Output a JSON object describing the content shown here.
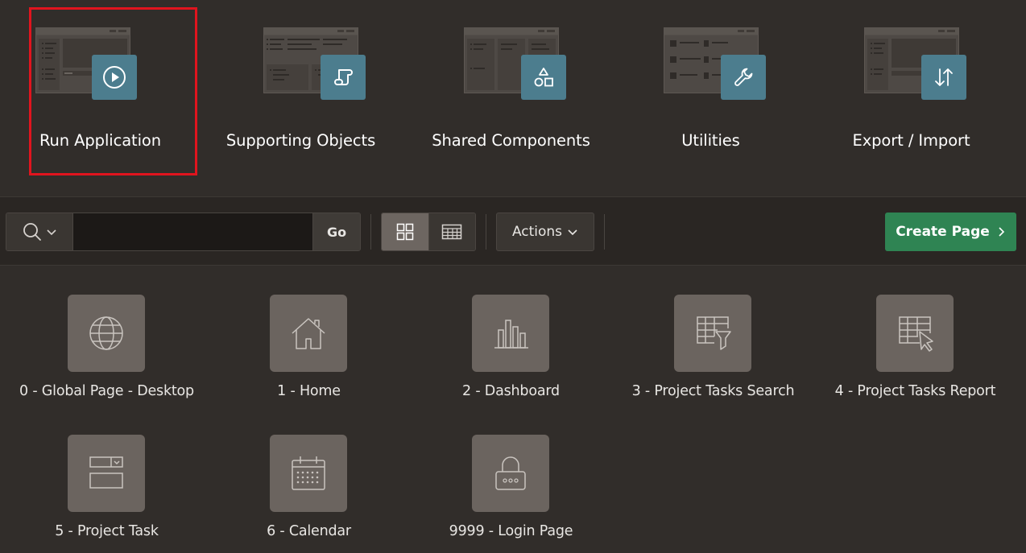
{
  "hero_tiles": [
    {
      "label": "Run Application",
      "icon": "play-icon",
      "selected": true
    },
    {
      "label": "Supporting Objects",
      "icon": "scroll-icon",
      "selected": false
    },
    {
      "label": "Shared Components",
      "icon": "shapes-icon",
      "selected": false
    },
    {
      "label": "Utilities",
      "icon": "wrench-icon",
      "selected": false
    },
    {
      "label": "Export / Import",
      "icon": "arrows-up-down-icon",
      "selected": false
    }
  ],
  "toolbar": {
    "search_placeholder": "",
    "search_value": "",
    "go_label": "Go",
    "actions_label": "Actions",
    "create_label": "Create Page",
    "view_mode": "icons"
  },
  "pages": [
    {
      "label": "0 - Global Page - Desktop",
      "icon": "globe-icon"
    },
    {
      "label": "1 - Home",
      "icon": "home-icon"
    },
    {
      "label": "2 - Dashboard",
      "icon": "bar-chart-icon"
    },
    {
      "label": "3 - Project Tasks Search",
      "icon": "table-filter-icon"
    },
    {
      "label": "4 - Project Tasks Report",
      "icon": "table-cursor-icon"
    },
    {
      "label": "5 - Project Task",
      "icon": "form-icon"
    },
    {
      "label": "6 - Calendar",
      "icon": "calendar-icon"
    },
    {
      "label": "9999 - Login Page",
      "icon": "lock-icon"
    }
  ],
  "colors": {
    "background": "#312d2a",
    "toolbar_background": "#2a2623",
    "hero_badge": "#4c7d8e",
    "page_icon_box": "#6b645f",
    "create_button": "#2f8453",
    "selection_outline": "#e0141e"
  }
}
